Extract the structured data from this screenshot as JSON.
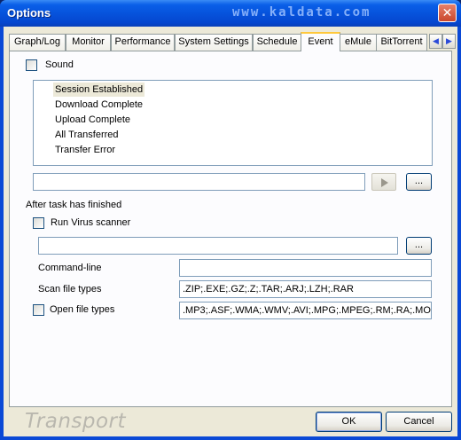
{
  "window": {
    "title": "Options",
    "watermark": "www.kaldata.com",
    "close_glyph": "✕"
  },
  "tabs": [
    {
      "label": "Graph/Log",
      "active": false
    },
    {
      "label": "Monitor",
      "active": false
    },
    {
      "label": "Performance",
      "active": false
    },
    {
      "label": "System Settings",
      "active": false
    },
    {
      "label": "Schedule",
      "active": false
    },
    {
      "label": "Event",
      "active": true
    },
    {
      "label": "eMule",
      "active": false
    },
    {
      "label": "BitTorrent",
      "active": false
    }
  ],
  "tab_scroll": {
    "left": "◀",
    "right": "▶"
  },
  "event": {
    "sound_label": "Sound",
    "sound_checked": false,
    "events": [
      "Session Established",
      "Download Complete",
      "Upload Complete",
      "All Transferred",
      "Transfer Error"
    ],
    "selected_event": "Session Established",
    "sound_path_value": "",
    "browse_label": "...",
    "after_task_label": "After task has finished",
    "run_virus_label": "Run Virus scanner",
    "run_virus_checked": false,
    "scanner_path_value": "",
    "scanner_browse_label": "...",
    "command_line_label": "Command-line",
    "command_line_value": "",
    "scan_types_label": "Scan file types",
    "scan_types_value": ".ZIP;.EXE;.GZ;.Z;.TAR;.ARJ;.LZH;.RAR",
    "open_types_label": "Open file types",
    "open_types_checked": false,
    "open_types_value": ".MP3;.ASF;.WMA;.WMV;.AVI;.MPG;.MPEG;.RM;.RA;.MO"
  },
  "footer": {
    "logo_text": "Transport",
    "ok_label": "OK",
    "cancel_label": "Cancel"
  },
  "colors": {
    "titlebar": "#0653dc",
    "dialog_bg": "#ece9d8",
    "active_tab_accent": "#ffc83c"
  }
}
